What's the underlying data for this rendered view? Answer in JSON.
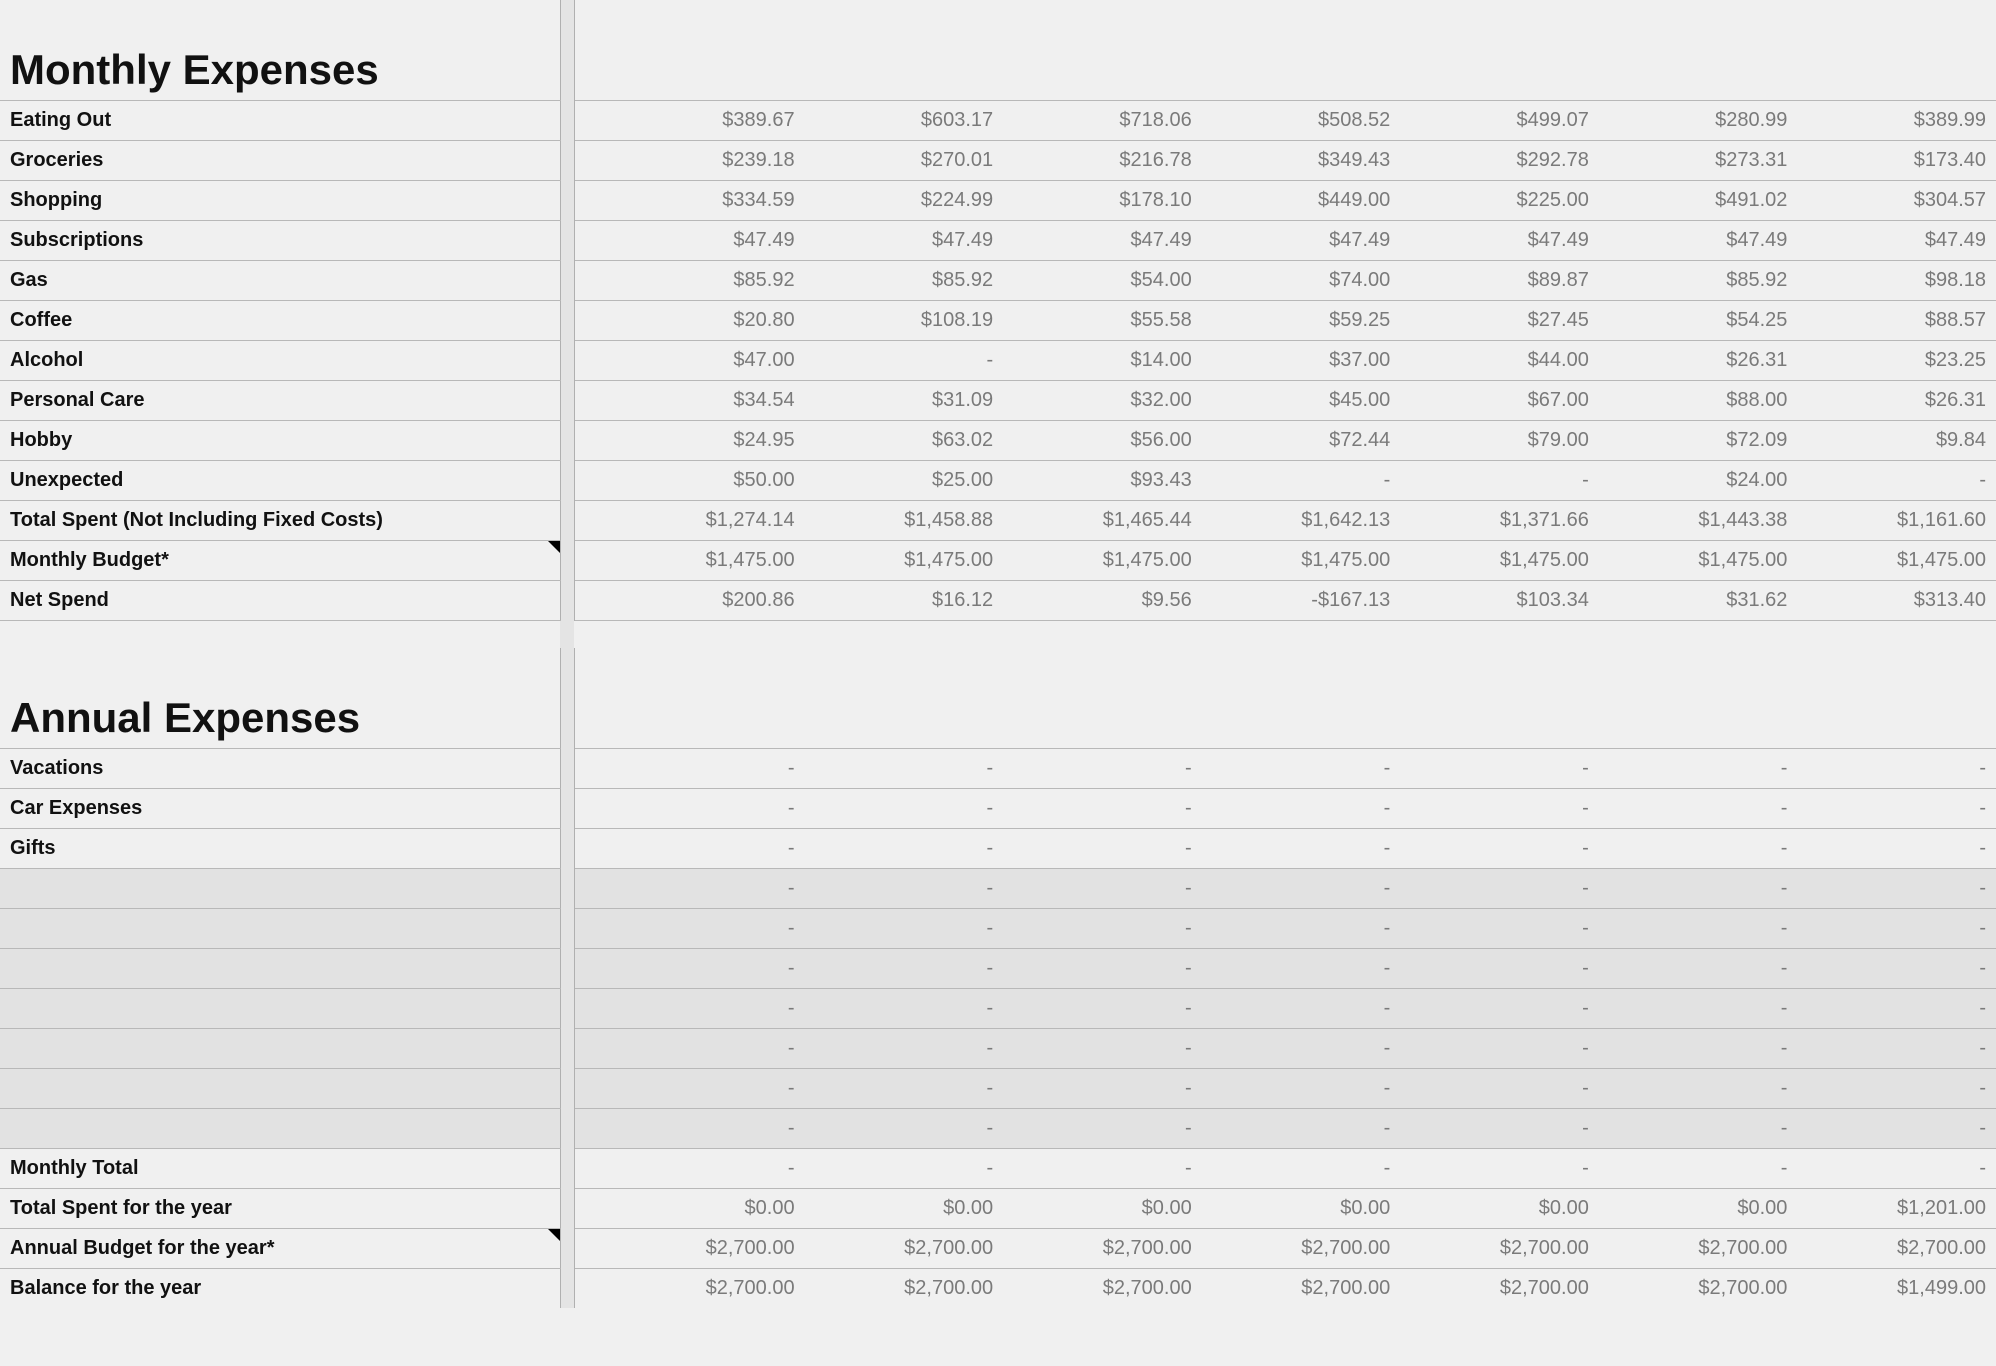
{
  "sections": {
    "monthly": {
      "title": "Monthly Expenses",
      "rows": [
        {
          "label": "Eating Out",
          "values": [
            "$389.67",
            "$603.17",
            "$718.06",
            "$508.52",
            "$499.07",
            "$280.99",
            "$389.99"
          ]
        },
        {
          "label": "Groceries",
          "values": [
            "$239.18",
            "$270.01",
            "$216.78",
            "$349.43",
            "$292.78",
            "$273.31",
            "$173.40"
          ]
        },
        {
          "label": "Shopping",
          "values": [
            "$334.59",
            "$224.99",
            "$178.10",
            "$449.00",
            "$225.00",
            "$491.02",
            "$304.57"
          ]
        },
        {
          "label": "Subscriptions",
          "values": [
            "$47.49",
            "$47.49",
            "$47.49",
            "$47.49",
            "$47.49",
            "$47.49",
            "$47.49"
          ]
        },
        {
          "label": "Gas",
          "values": [
            "$85.92",
            "$85.92",
            "$54.00",
            "$74.00",
            "$89.87",
            "$85.92",
            "$98.18"
          ]
        },
        {
          "label": "Coffee",
          "values": [
            "$20.80",
            "$108.19",
            "$55.58",
            "$59.25",
            "$27.45",
            "$54.25",
            "$88.57"
          ]
        },
        {
          "label": "Alcohol",
          "values": [
            "$47.00",
            "-",
            "$14.00",
            "$37.00",
            "$44.00",
            "$26.31",
            "$23.25"
          ]
        },
        {
          "label": "Personal Care",
          "values": [
            "$34.54",
            "$31.09",
            "$32.00",
            "$45.00",
            "$67.00",
            "$88.00",
            "$26.31"
          ]
        },
        {
          "label": "Hobby",
          "values": [
            "$24.95",
            "$63.02",
            "$56.00",
            "$72.44",
            "$79.00",
            "$72.09",
            "$9.84"
          ]
        },
        {
          "label": "Unexpected",
          "values": [
            "$50.00",
            "$25.00",
            "$93.43",
            "-",
            "-",
            "$24.00",
            "-"
          ]
        },
        {
          "label": "Total Spent (Not Including Fixed Costs)",
          "values": [
            "$1,274.14",
            "$1,458.88",
            "$1,465.44",
            "$1,642.13",
            "$1,371.66",
            "$1,443.38",
            "$1,161.60"
          ]
        },
        {
          "label": "Monthly Budget*",
          "note": true,
          "values": [
            "$1,475.00",
            "$1,475.00",
            "$1,475.00",
            "$1,475.00",
            "$1,475.00",
            "$1,475.00",
            "$1,475.00"
          ]
        },
        {
          "label": "Net Spend",
          "values": [
            "$200.86",
            "$16.12",
            "$9.56",
            "-$167.13",
            "$103.34",
            "$31.62",
            "$313.40"
          ]
        }
      ]
    },
    "annual": {
      "title": "Annual Expenses",
      "rows": [
        {
          "label": "Vacations",
          "values": [
            "-",
            "-",
            "-",
            "-",
            "-",
            "-",
            "-"
          ]
        },
        {
          "label": "Car Expenses",
          "values": [
            "-",
            "-",
            "-",
            "-",
            "-",
            "-",
            "-"
          ]
        },
        {
          "label": "Gifts",
          "values": [
            "-",
            "-",
            "-",
            "-",
            "-",
            "-",
            "-"
          ]
        },
        {
          "label": "",
          "shaded": true,
          "values": [
            "-",
            "-",
            "-",
            "-",
            "-",
            "-",
            "-"
          ]
        },
        {
          "label": "",
          "shaded": true,
          "values": [
            "-",
            "-",
            "-",
            "-",
            "-",
            "-",
            "-"
          ]
        },
        {
          "label": "",
          "shaded": true,
          "values": [
            "-",
            "-",
            "-",
            "-",
            "-",
            "-",
            "-"
          ]
        },
        {
          "label": "",
          "shaded": true,
          "values": [
            "-",
            "-",
            "-",
            "-",
            "-",
            "-",
            "-"
          ]
        },
        {
          "label": "",
          "shaded": true,
          "values": [
            "-",
            "-",
            "-",
            "-",
            "-",
            "-",
            "-"
          ]
        },
        {
          "label": "",
          "shaded": true,
          "values": [
            "-",
            "-",
            "-",
            "-",
            "-",
            "-",
            "-"
          ]
        },
        {
          "label": "",
          "shaded": true,
          "values": [
            "-",
            "-",
            "-",
            "-",
            "-",
            "-",
            "-"
          ]
        },
        {
          "label": "Monthly Total",
          "values": [
            "-",
            "-",
            "-",
            "-",
            "-",
            "-",
            "-"
          ]
        },
        {
          "label": "Total Spent for the year",
          "values": [
            "$0.00",
            "$0.00",
            "$0.00",
            "$0.00",
            "$0.00",
            "$0.00",
            "$1,201.00"
          ]
        },
        {
          "label": "Annual Budget for the year*",
          "note": true,
          "values": [
            "$2,700.00",
            "$2,700.00",
            "$2,700.00",
            "$2,700.00",
            "$2,700.00",
            "$2,700.00",
            "$2,700.00"
          ]
        },
        {
          "label": "Balance for the year",
          "values": [
            "$2,700.00",
            "$2,700.00",
            "$2,700.00",
            "$2,700.00",
            "$2,700.00",
            "$2,700.00",
            "$1,499.00"
          ]
        }
      ]
    }
  }
}
